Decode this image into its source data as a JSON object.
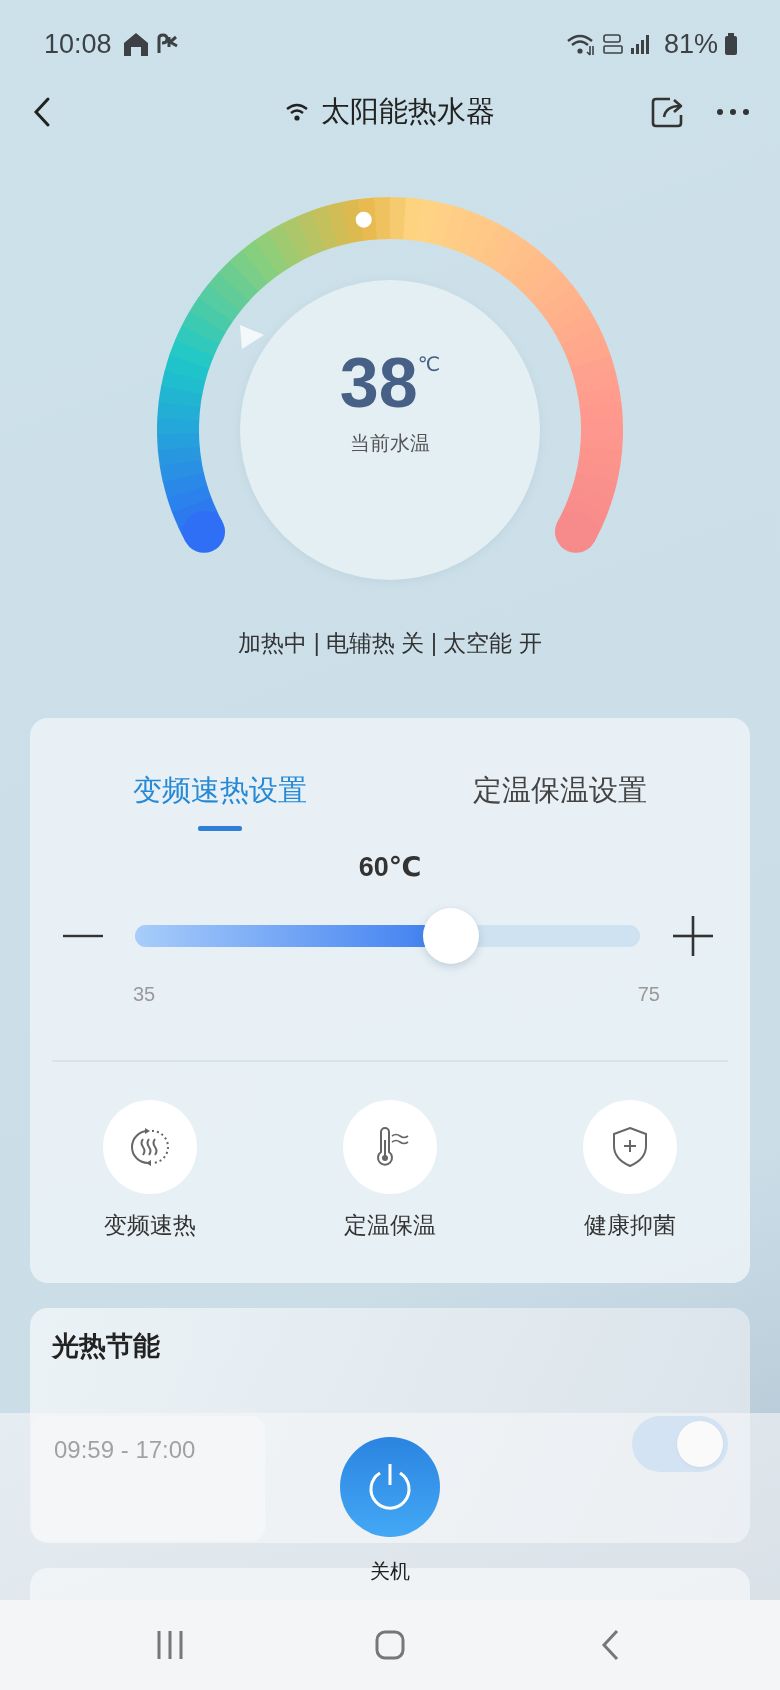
{
  "status_bar": {
    "time": "10:08",
    "battery": "81%"
  },
  "header": {
    "title": "太阳能热水器"
  },
  "gauge": {
    "value": "38",
    "unit": "℃",
    "label": "当前水温"
  },
  "status_line": "加热中 | 电辅热 关 | 太空能 开",
  "settings": {
    "tabs": [
      {
        "label": "变频速热设置",
        "selected": true
      },
      {
        "label": "定温保温设置",
        "selected": false
      }
    ],
    "target": "60℃",
    "level": 0.625,
    "min": "35",
    "max": "75",
    "features": [
      {
        "label": "变频速热"
      },
      {
        "label": "定温保温"
      },
      {
        "label": "健康抑菌"
      }
    ]
  },
  "energy": {
    "title": "光热节能",
    "schedule": "09:59 - 17:00",
    "on": true
  },
  "power": {
    "label": "关机"
  }
}
